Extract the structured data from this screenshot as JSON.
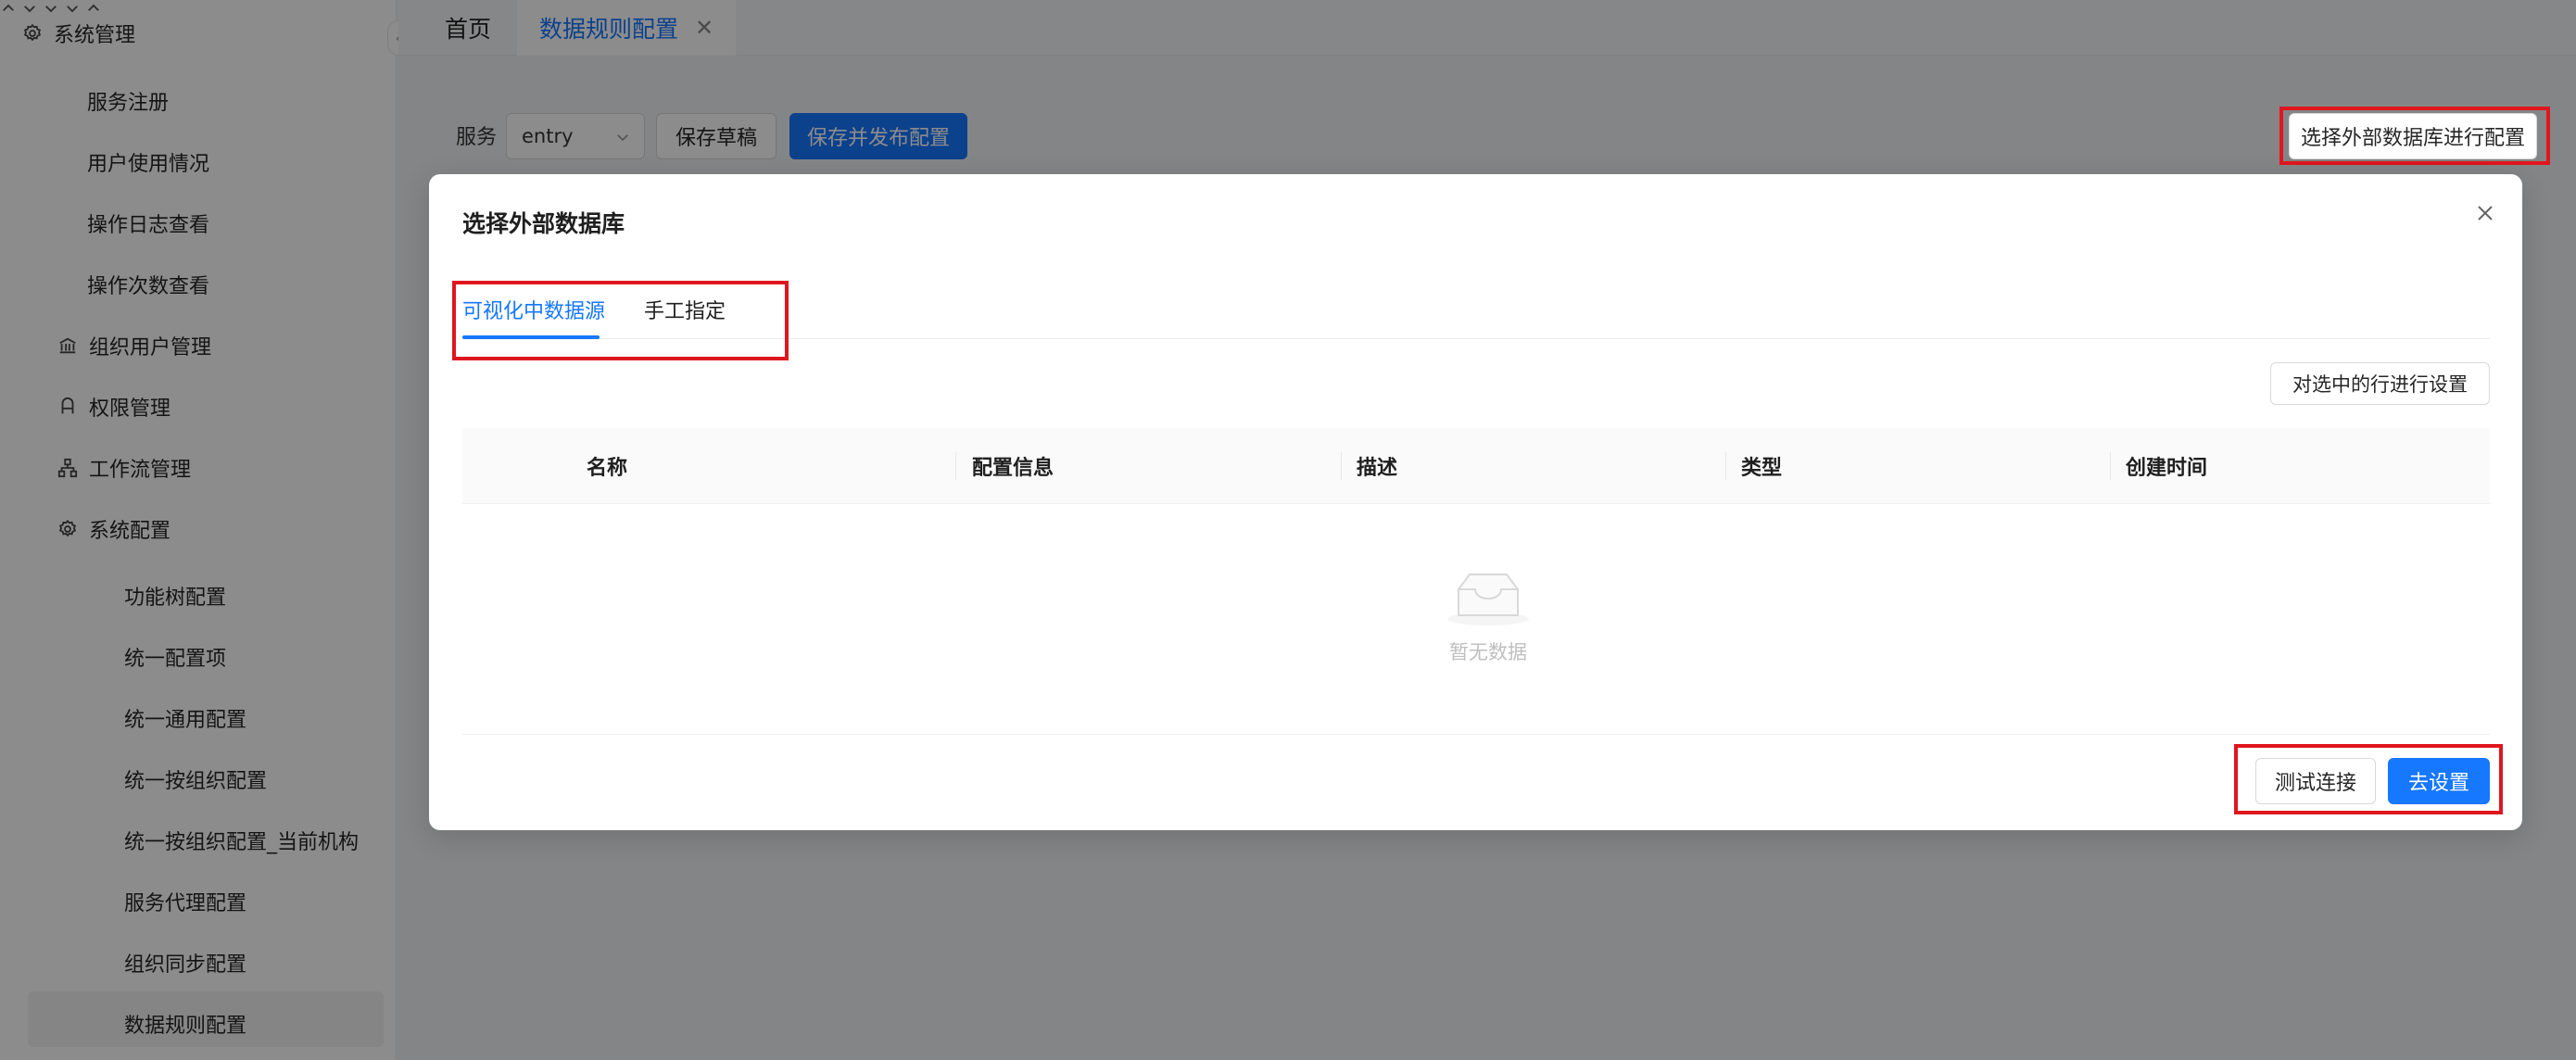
{
  "sidebar": {
    "group_title": "系统管理",
    "items": [
      {
        "label": "服务注册"
      },
      {
        "label": "用户使用情况"
      },
      {
        "label": "操作日志查看"
      },
      {
        "label": "操作次数查看"
      }
    ],
    "groups": [
      {
        "label": "组织用户管理",
        "icon": "bank-icon"
      },
      {
        "label": "权限管理",
        "icon": "user-icon"
      },
      {
        "label": "工作流管理",
        "icon": "cluster-icon"
      }
    ],
    "config_group": {
      "label": "系统配置",
      "items": [
        {
          "label": "功能树配置"
        },
        {
          "label": "统一配置项"
        },
        {
          "label": "统一通用配置"
        },
        {
          "label": "统一按组织配置"
        },
        {
          "label": "统一按组织配置_当前机构"
        },
        {
          "label": "服务代理配置"
        },
        {
          "label": "组织同步配置"
        },
        {
          "label": "数据规则配置"
        }
      ]
    }
  },
  "topbar": {
    "home_tab": "首页",
    "active_tab": "数据规则配置"
  },
  "toolbar": {
    "service_label": "服务",
    "service_value": "entry",
    "save_draft": "保存草稿",
    "save_publish": "保存并发布配置",
    "external_db": "选择外部数据库进行配置"
  },
  "modal": {
    "title": "选择外部数据库",
    "tabs": [
      "可视化中数据源",
      "手工指定"
    ],
    "row_setting": "对选中的行进行设置",
    "columns": [
      "名称",
      "配置信息",
      "描述",
      "类型",
      "创建时间"
    ],
    "empty_text": "暂无数据",
    "test_connection": "测试连接",
    "go_setting": "去设置"
  },
  "colors": {
    "primary": "#1677ff",
    "highlight_red": "#e0161f"
  }
}
